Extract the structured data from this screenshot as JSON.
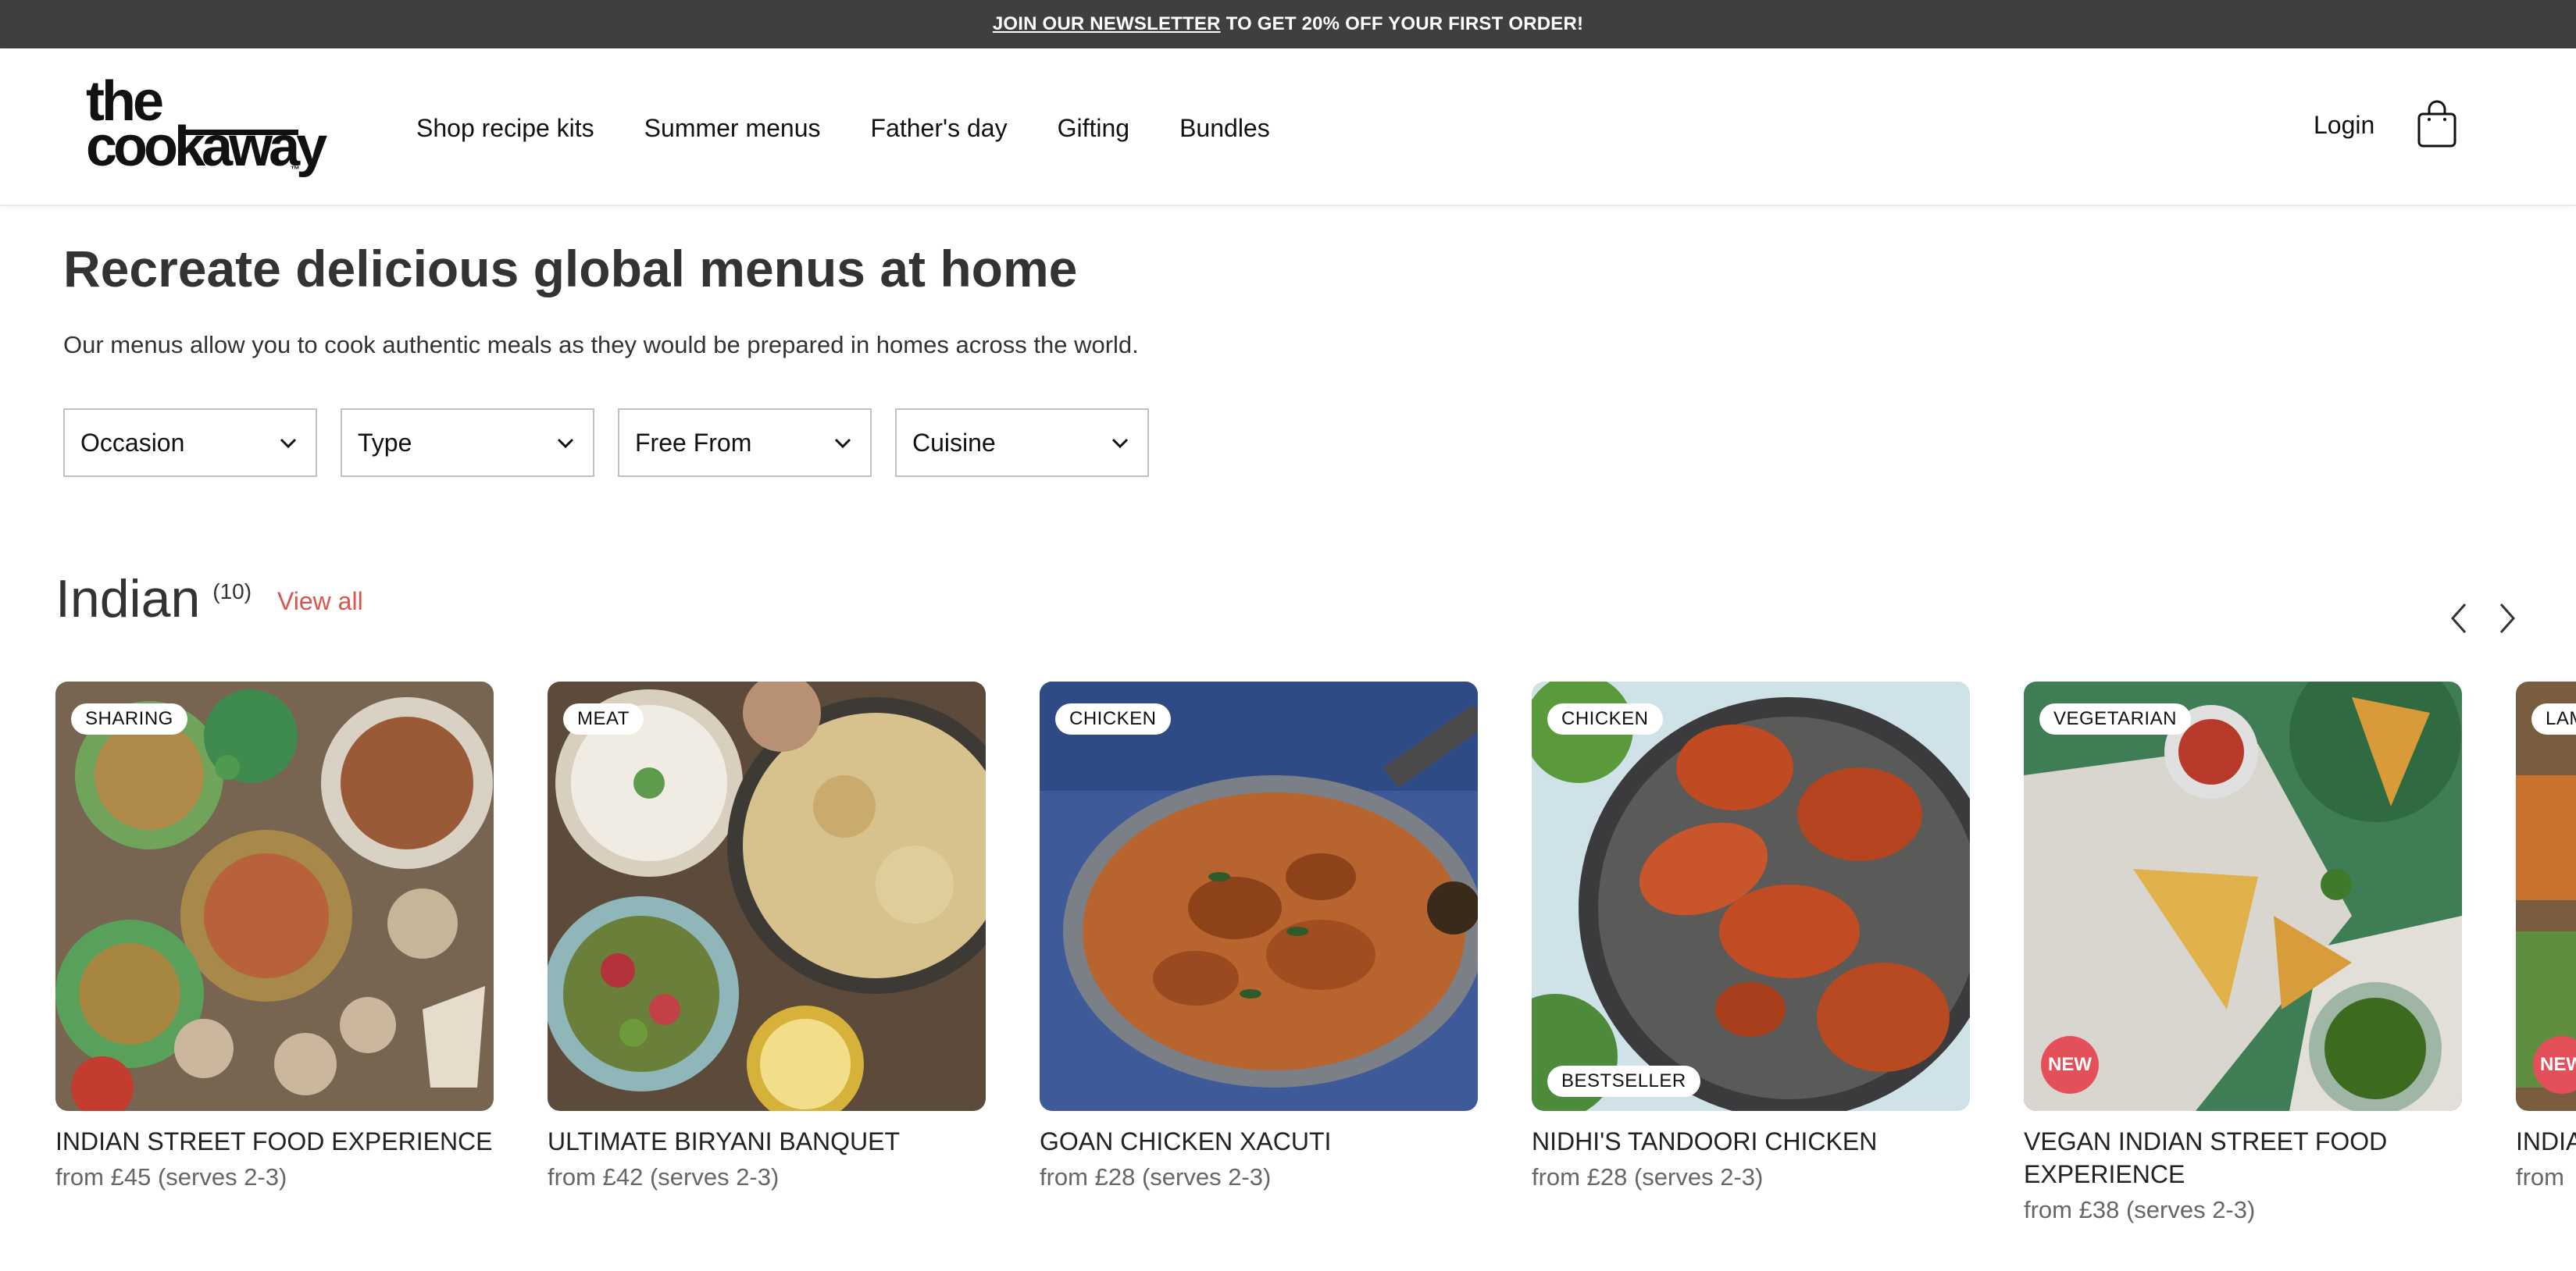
{
  "promo": {
    "link_text": "JOIN OUR NEWSLETTER",
    "message": "TO GET 20% OFF YOUR FIRST ORDER!"
  },
  "header": {
    "logo": {
      "line1": "the",
      "line2": "cookaway",
      "tm": "™"
    },
    "nav": [
      "Shop recipe kits",
      "Summer menus",
      "Father's day",
      "Gifting",
      "Bundles"
    ],
    "login_label": "Login",
    "cart_icon": "shopping-bag-icon"
  },
  "intro": {
    "title": "Recreate delicious global menus at home",
    "subtitle": "Our menus allow you to cook authentic meals as they would be prepared in homes across the world."
  },
  "filters": [
    "Occasion",
    "Type",
    "Free From",
    "Cuisine"
  ],
  "section": {
    "title": "Indian",
    "count": "(10)",
    "view_all_label": "View all",
    "prev_icon": "chevron-left-icon",
    "next_icon": "chevron-right-icon"
  },
  "products": [
    {
      "category": "SHARING",
      "name": "INDIAN STREET FOOD EXPERIENCE",
      "price": "from £45 (serves 2-3)",
      "bestseller": "",
      "new": ""
    },
    {
      "category": "MEAT",
      "name": "ULTIMATE BIRYANI BANQUET",
      "price": "from £42 (serves 2-3)",
      "bestseller": "",
      "new": ""
    },
    {
      "category": "CHICKEN",
      "name": "GOAN CHICKEN XACUTI",
      "price": "from £28 (serves 2-3)",
      "bestseller": "",
      "new": ""
    },
    {
      "category": "CHICKEN",
      "name": "NIDHI'S TANDOORI CHICKEN",
      "price": "from £28 (serves 2-3)",
      "bestseller": "BESTSELLER",
      "new": ""
    },
    {
      "category": "VEGETARIAN",
      "name": "VEGAN INDIAN STREET FOOD EXPERIENCE",
      "price": "from £38 (serves 2-3)",
      "bestseller": "",
      "new": "NEW"
    },
    {
      "category": "LAM",
      "name": "INDIA",
      "price": "from",
      "bestseller": "",
      "new": "NEW"
    }
  ],
  "colors": {
    "promo_bg": "#3f3f3f",
    "accent_red": "#d9564e",
    "new_badge": "#e4505a"
  }
}
